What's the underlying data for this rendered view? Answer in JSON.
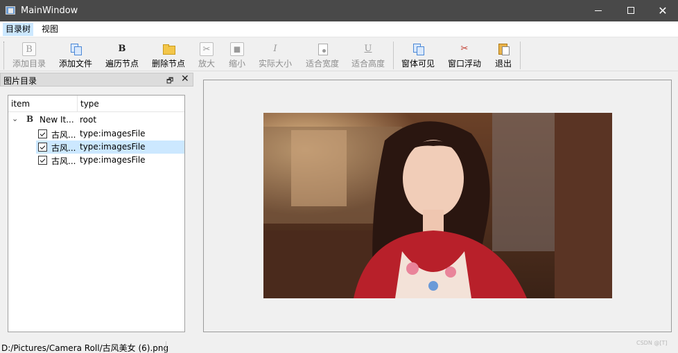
{
  "window": {
    "title": "MainWindow"
  },
  "menu": {
    "items": [
      "目录树",
      "视图"
    ]
  },
  "toolbar": {
    "buttons": [
      {
        "label": "添加目录",
        "icon": "bold-b-icon",
        "enabled": false
      },
      {
        "label": "添加文件",
        "icon": "copy-icon",
        "enabled": true
      },
      {
        "label": "遍历节点",
        "icon": "bold-b-icon",
        "enabled": true
      },
      {
        "label": "删除节点",
        "icon": "open-folder-icon",
        "enabled": true
      },
      {
        "label": "放大",
        "icon": "scissors-icon",
        "enabled": false
      },
      {
        "label": "缩小",
        "icon": "dot-square-icon",
        "enabled": false
      },
      {
        "label": "实际大小",
        "icon": "italic-icon",
        "enabled": false
      },
      {
        "label": "适合宽度",
        "icon": "page-icon",
        "enabled": false
      },
      {
        "label": "适合高度",
        "icon": "underline-icon",
        "enabled": false
      },
      {
        "label": "窗体可见",
        "icon": "copy-icon",
        "enabled": true
      },
      {
        "label": "窗口浮动",
        "icon": "scissors-icon",
        "enabled": true
      },
      {
        "label": "退出",
        "icon": "paste-icon",
        "enabled": true
      }
    ]
  },
  "dock": {
    "title": "图片目录",
    "float_glyph": "🗗",
    "close_glyph": "✕"
  },
  "tree": {
    "columns": [
      "item",
      "type"
    ],
    "root": {
      "expander": "⌄",
      "icon_text": "B",
      "item": "New It...",
      "type": "root"
    },
    "children": [
      {
        "checked": true,
        "item": "古风...",
        "type": "type:imagesFile",
        "selected": false
      },
      {
        "checked": true,
        "item": "古风...",
        "type": "type:imagesFile",
        "selected": true
      },
      {
        "checked": true,
        "item": "古风...",
        "type": "type:imagesFile",
        "selected": false
      }
    ]
  },
  "status": {
    "path": "D:/Pictures/Camera Roll/古风美女 (6).png"
  },
  "watermark": "CSDN @[T]",
  "colors": {
    "titlebar": "#494949",
    "selection": "#cce8ff",
    "menu_active": "#cce8ff"
  }
}
